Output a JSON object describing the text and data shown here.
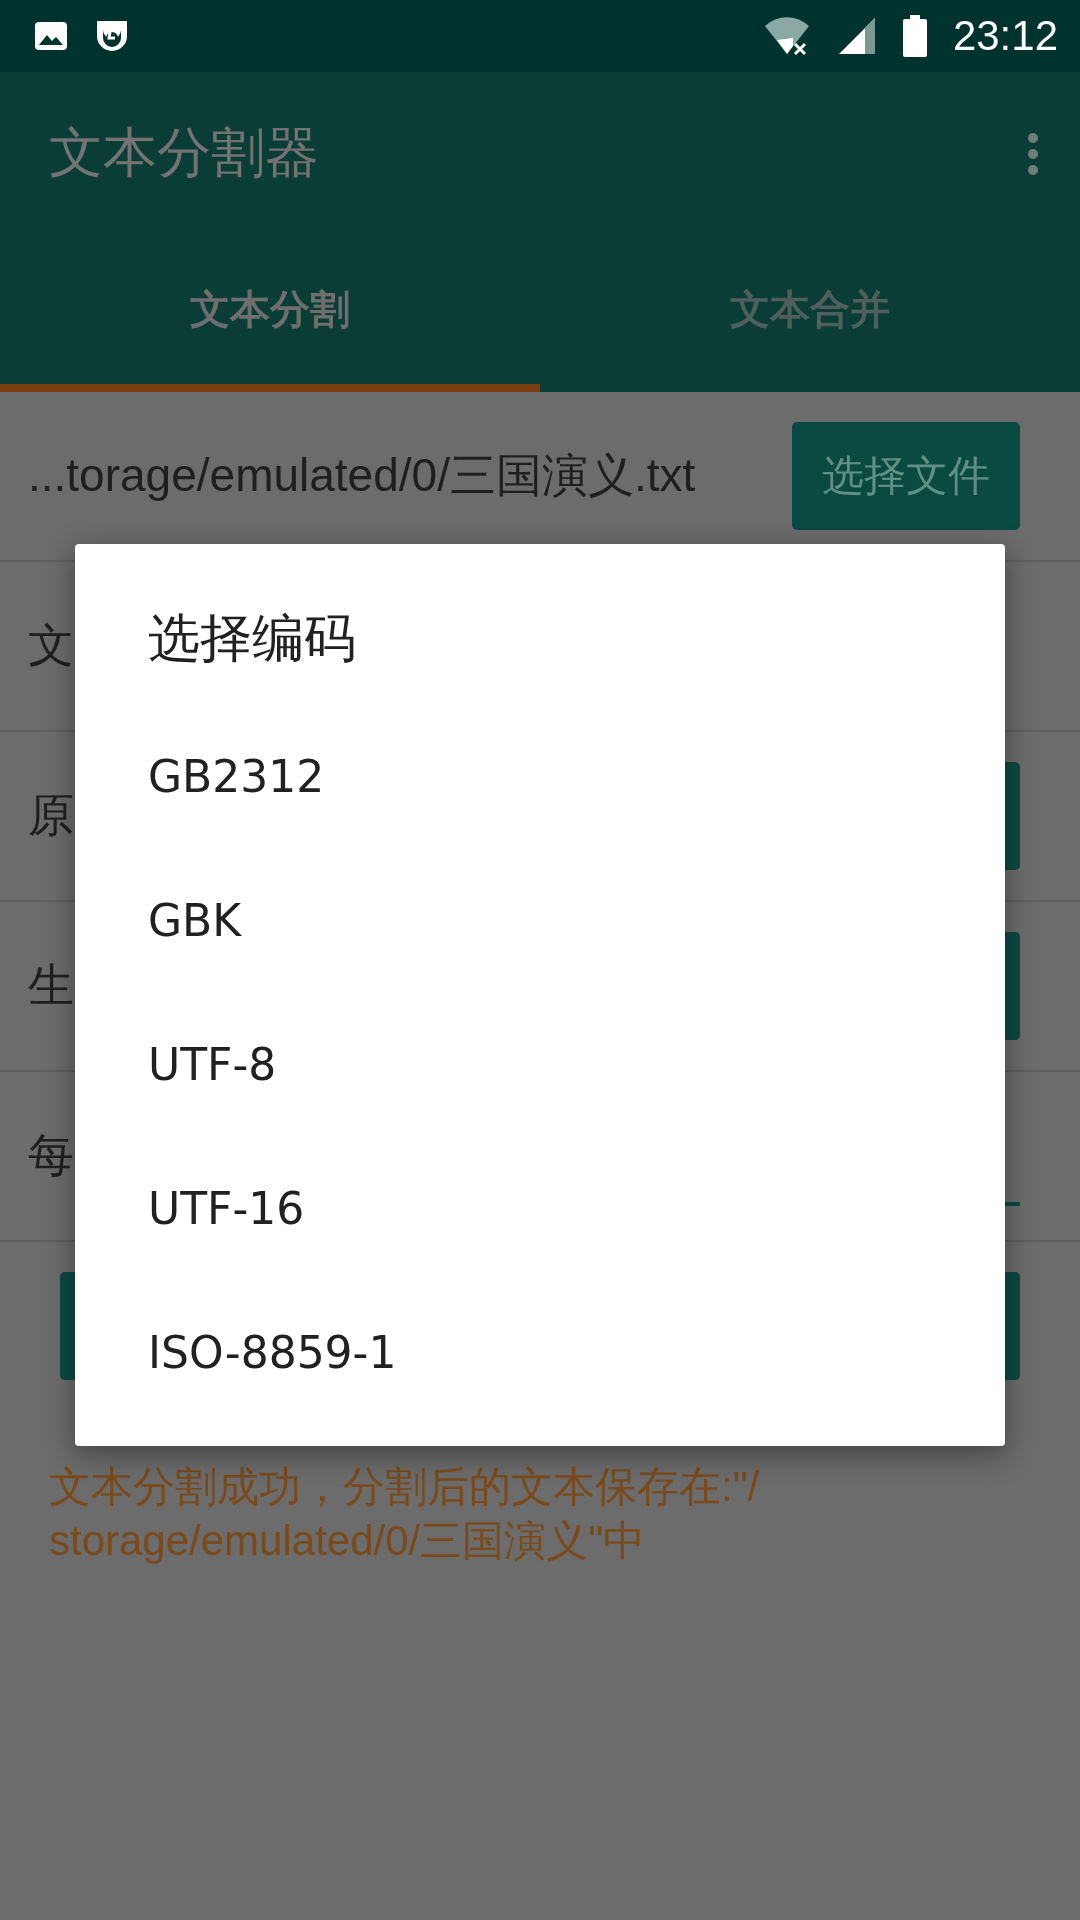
{
  "status_bar": {
    "time": "23:12"
  },
  "app_bar": {
    "title": "文本分割器"
  },
  "tabs": [
    {
      "label": "文本分割",
      "selected": true
    },
    {
      "label": "文本合并",
      "selected": false
    }
  ],
  "form": {
    "file_path": "...torage/emulated/0/三国演义.txt",
    "select_file_button": "选择文件",
    "rows": [
      {
        "kind": "plain",
        "label": "文"
      },
      {
        "kind": "button",
        "label": "原"
      },
      {
        "kind": "button",
        "label": "生"
      },
      {
        "kind": "input",
        "label": "每"
      }
    ]
  },
  "message_lines": [
    "文本分割成功，分割后的文本保存在:\"/",
    "storage/emulated/0/三国演义\"中"
  ],
  "dialog": {
    "title": "选择编码",
    "options": [
      "GB2312",
      "GBK",
      "UTF-8",
      "UTF-16",
      "ISO-8859-1"
    ]
  }
}
